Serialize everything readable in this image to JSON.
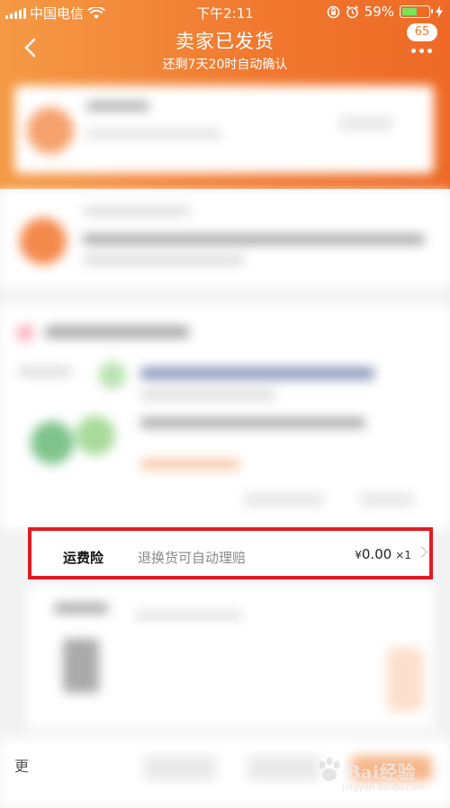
{
  "status_bar": {
    "carrier": "中国电信",
    "time": "下午2:11",
    "battery_percent": "59%",
    "battery_level": 0.59
  },
  "header": {
    "title": "卖家已发货",
    "subtitle": "还剩7天20时自动确认",
    "message_count": "65"
  },
  "shipping_insurance": {
    "label": "运费险",
    "description": "退换货可自动理赔",
    "currency": "¥",
    "price": "0.00",
    "quantity": "×1"
  },
  "bottom_bar": {
    "more_label": "更"
  },
  "watermark": {
    "brand": "Bai",
    "brand_suffix": "经验",
    "url": "jingyan.baidu.com"
  },
  "colors": {
    "header_gradient_start": "#f59a45",
    "header_gradient_end": "#ee6a26",
    "highlight_border": "#e21a22"
  }
}
